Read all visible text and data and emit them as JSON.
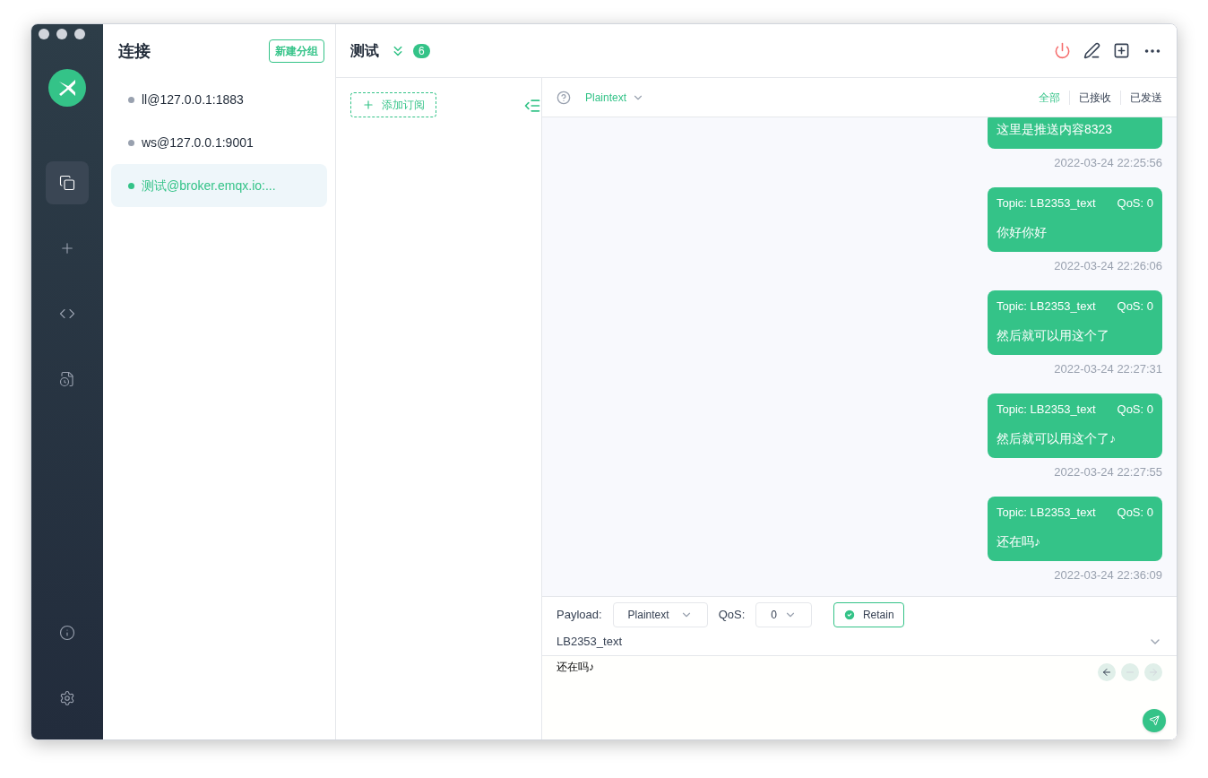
{
  "sidebar": {
    "items": [
      {
        "kind": "connections",
        "selected": true
      },
      {
        "kind": "new",
        "selected": false
      },
      {
        "kind": "script",
        "selected": false
      },
      {
        "kind": "log",
        "selected": false
      }
    ],
    "bottom_items": [
      {
        "kind": "about"
      },
      {
        "kind": "settings"
      }
    ]
  },
  "connections": {
    "title": "连接",
    "new_group_button": "新建分组",
    "items": [
      {
        "name": "ll@127.0.0.1:1883",
        "connected": false,
        "selected": false
      },
      {
        "name": "ws@127.0.0.1:9001",
        "connected": false,
        "selected": false
      },
      {
        "name": "测试@broker.emqx.io:...",
        "connected": true,
        "selected": true
      }
    ]
  },
  "header": {
    "title": "测试",
    "count": "6"
  },
  "subscriptions": {
    "add_button": "添加订阅"
  },
  "messages_toolbar": {
    "format": "Plaintext",
    "filters": [
      {
        "label": "全部",
        "selected": true
      },
      {
        "label": "已接收",
        "selected": false
      },
      {
        "label": "已发送",
        "selected": false
      }
    ]
  },
  "messages": [
    {
      "payload": "这里是推送内容8323",
      "time": "2022-03-24 22:25:56"
    },
    {
      "topic": "Topic: LB2353_text",
      "qos": "QoS: 0",
      "payload": "你好你好",
      "time": "2022-03-24 22:26:06"
    },
    {
      "topic": "Topic: LB2353_text",
      "qos": "QoS: 0",
      "payload": "然后就可以用这个了",
      "time": "2022-03-24 22:27:31"
    },
    {
      "topic": "Topic: LB2353_text",
      "qos": "QoS: 0",
      "payload": "然后就可以用这个了♪",
      "time": "2022-03-24 22:27:55"
    },
    {
      "topic": "Topic: LB2353_text",
      "qos": "QoS: 0",
      "payload": "还在吗♪",
      "time": "2022-03-24 22:36:09"
    }
  ],
  "composer": {
    "payload_label": "Payload:",
    "payload_format": "Plaintext",
    "qos_label": "QoS:",
    "qos": "0",
    "retain_label": "Retain",
    "retain": true,
    "topic": "LB2353_text",
    "message": "还在吗♪"
  }
}
